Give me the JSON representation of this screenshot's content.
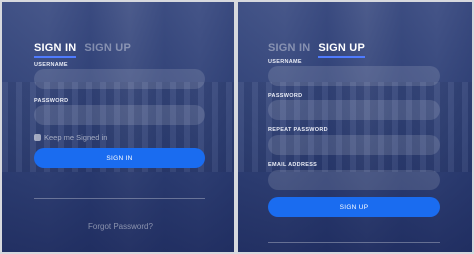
{
  "signin": {
    "tab_signin": "SIGN IN",
    "tab_signup": "SIGN UP",
    "username_label": "USERNAME",
    "username_value": "",
    "password_label": "PASSWORD",
    "password_value": "",
    "keep_signed_in": "Keep me Signed in",
    "button": "SIGN IN",
    "forgot": "Forgot Password?"
  },
  "signup": {
    "tab_signin": "SIGN IN",
    "tab_signup": "SIGN UP",
    "username_label": "USERNAME",
    "username_value": "",
    "password_label": "PASSWORD",
    "password_value": "",
    "repeat_label": "REPEAT PASSWORD",
    "repeat_value": "",
    "email_label": "EMAIL ADDRESS",
    "email_value": "",
    "button": "SIGN UP"
  },
  "colors": {
    "accent": "#1a6cf0",
    "panel": "#2c3f7a"
  }
}
